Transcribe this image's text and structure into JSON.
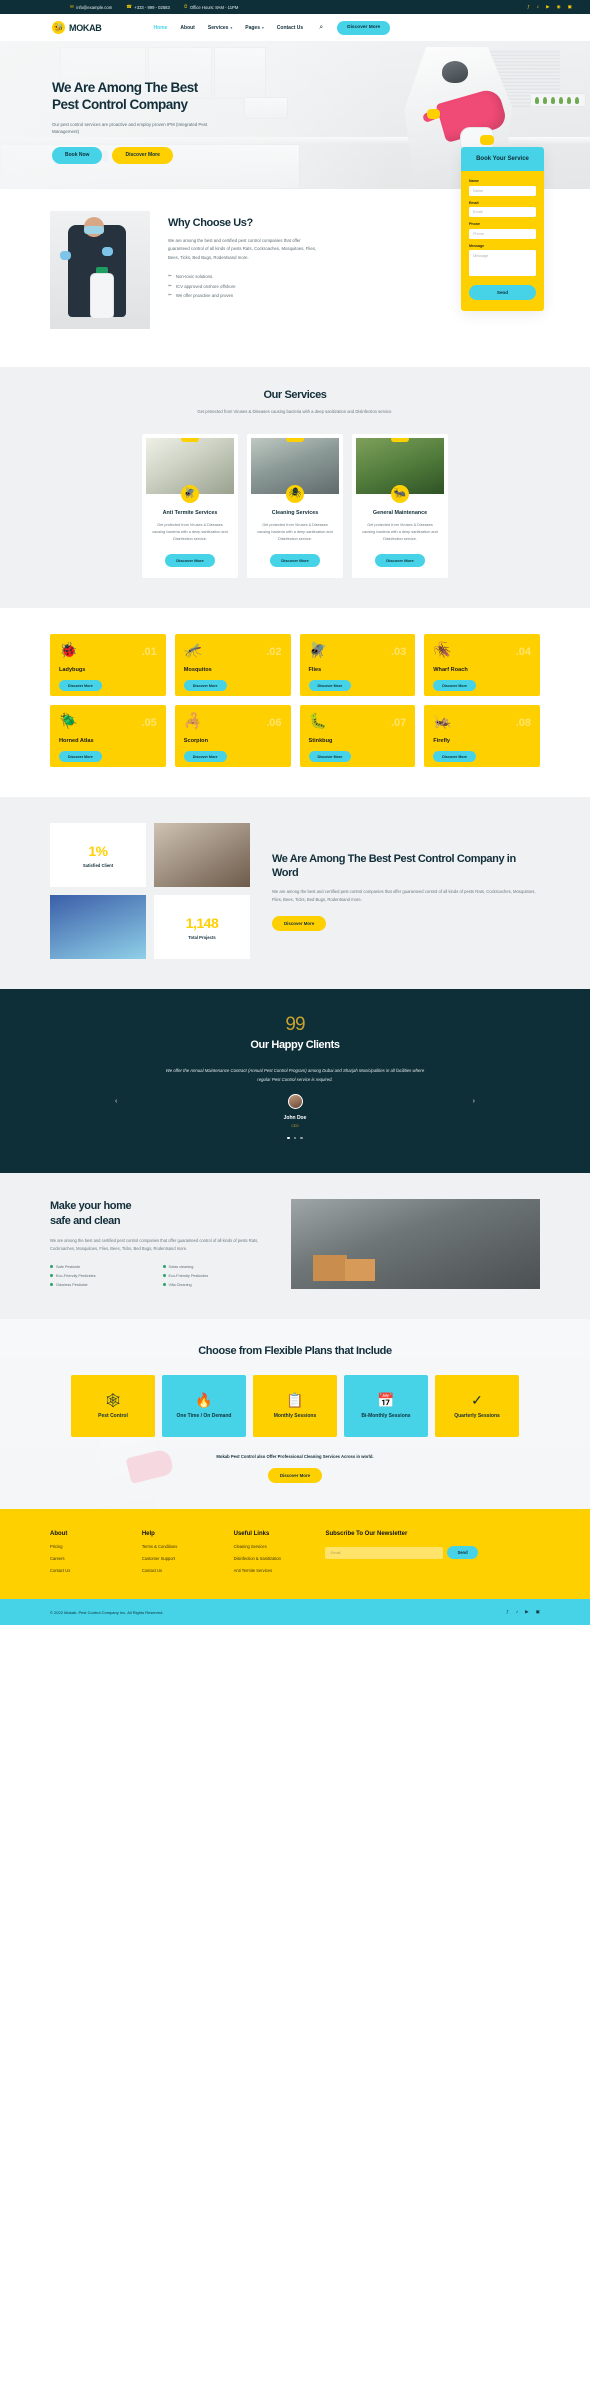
{
  "topbar": {
    "email": "info@example.com",
    "phone": "+333 - 999 - 02583",
    "hours": "Office Hours: 8AM - 11PM",
    "social": [
      "f",
      "t",
      "yt",
      "rss",
      "ig"
    ]
  },
  "nav": {
    "brand": "MOKAB",
    "links": [
      {
        "label": "Home",
        "active": true,
        "caret": ""
      },
      {
        "label": "About",
        "active": false,
        "caret": ""
      },
      {
        "label": "Services",
        "active": false,
        "caret": "▾"
      },
      {
        "label": "Pages",
        "active": false,
        "caret": "▾"
      },
      {
        "label": "Contact Us",
        "active": false,
        "caret": ""
      }
    ],
    "search_icon": "⌕",
    "cta": "Discover More"
  },
  "hero": {
    "title_line1": "We Are Among The Best",
    "title_line2": "Pest Control Company",
    "subtitle": "Our pest control services are proactive and employ proven IPM (Integrated Pest Management)",
    "btn_primary": "Book Now",
    "btn_secondary": "Discover More"
  },
  "book_form": {
    "heading": "Book Your Service",
    "fields": [
      {
        "label": "Name",
        "placeholder": "Name"
      },
      {
        "label": "Email",
        "placeholder": "Email"
      },
      {
        "label": "Phone",
        "placeholder": "Phone"
      },
      {
        "label": "Message",
        "placeholder": "Message"
      }
    ],
    "send": "Send"
  },
  "why": {
    "heading": "Why Choose Us?",
    "paragraph": "We are among the best and certified pest control companies that offer guaranteed control of all kinds of pests Rats, Cockroaches, Mosquitoes, Flies, Bees, Ticks, Bed Bugs, Rodentsand more.",
    "bullets": [
      "Non-toxic solutions.",
      "ICV approved onshore offshore",
      "We offer proactive and proven"
    ]
  },
  "services": {
    "heading": "Our Services",
    "subtitle": "Get protected from Viruses & Diseases causing bacteria with a deep sanitization and Disinfection service.",
    "cards": [
      {
        "title": "Anti Termite Services",
        "desc": "Get protected from Viruses & Diseases causing bacteria with a deep sanitization and Disinfection service.",
        "button": "Discover More",
        "icon": "🪰"
      },
      {
        "title": "Cleaning Services",
        "desc": "Get protected from Viruses & Diseases causing bacteria with a deep sanitization and Disinfection service.",
        "button": "Discover More",
        "icon": "🕷"
      },
      {
        "title": "General Maintenance",
        "desc": "Get protected from Viruses & Diseases causing bacteria with a deep sanitization and Disinfection service.",
        "button": "Discover More",
        "icon": "🐜"
      }
    ]
  },
  "pests": {
    "items": [
      {
        "num": ".01",
        "name": "Ladybugs",
        "icon": "🐞",
        "button": "Discover More"
      },
      {
        "num": ".02",
        "name": "Mosquitos",
        "icon": "🦟",
        "button": "Discover More"
      },
      {
        "num": ".03",
        "name": "Flies",
        "icon": "🪰",
        "button": "Discover More"
      },
      {
        "num": ".04",
        "name": "Wharf Roach",
        "icon": "🪳",
        "button": "Discover More"
      },
      {
        "num": ".05",
        "name": "Horned Atlas",
        "icon": "🪲",
        "button": "Discover More"
      },
      {
        "num": ".06",
        "name": "Scorpion",
        "icon": "🦂",
        "button": "Discover More"
      },
      {
        "num": ".07",
        "name": "Stinkbug",
        "icon": "🐛",
        "button": "Discover More"
      },
      {
        "num": ".08",
        "name": "Firefly",
        "icon": "🦗",
        "button": "Discover More"
      }
    ]
  },
  "word": {
    "stats": [
      {
        "value": "1%",
        "label": "Satisfied Client"
      },
      {
        "value": "1,148",
        "label": "Total Projects"
      }
    ],
    "heading": "We Are Among The Best Pest Control Company in Word",
    "paragraph": "We are among the best and certified pest control companies that offer guaranteed control of all kinds of pests Rats, Cockroaches, Mosquitoes, Flies, Bees, Ticks, Bed Bugs, Rodentsand more.",
    "button": "Discover More"
  },
  "testimonial": {
    "quote_mark": "99",
    "heading": "Our Happy Clients",
    "quote": "We offer the Annual Maintenance Contract (Annual Pest Control Program) among Dubai and Sharjah Municipalities in all facilities where regular Pest Control service is required.",
    "name": "John Doe",
    "role": "CEO",
    "prev": "‹",
    "next": "›",
    "dots": 3,
    "active_dot": 0
  },
  "safe": {
    "heading_line1": "Make your home",
    "heading_line2": "safe and clean",
    "paragraph": "We are among the best and certified pest control companies that offer guaranteed control of all kinds of pests Rats, Cockroaches, Mosquitoes, Flies, Bees, Ticks, Bed Bugs, Rodentsand more.",
    "features": [
      "Safe Pesticide",
      "Sofas cleaning",
      "Eco-Friendly Pesticides",
      "Eco-Friendly Pesticides",
      "Odorless Pesticide",
      "Villa Cleaning"
    ]
  },
  "plans": {
    "heading": "Choose from Flexible Plans that Include",
    "cards": [
      {
        "label": "Pest Control",
        "icon": "🕸",
        "color": "yellow"
      },
      {
        "label": "One Time / On Demand",
        "icon": "🔥",
        "color": "cyan"
      },
      {
        "label": "Monthly Sessions",
        "icon": "📋",
        "color": "yellow"
      },
      {
        "label": "Bi-Monthly Sessions",
        "icon": "📅",
        "color": "cyan"
      },
      {
        "label": "Quarterly Sessions",
        "icon": "✓",
        "color": "yellow"
      }
    ],
    "note": "Mokab Pest Control also Offer Professional Cleaning Services Across in world.",
    "button": "Discover More"
  },
  "footer": {
    "columns": [
      {
        "heading": "About",
        "links": [
          "Pricing",
          "Careers",
          "Contact Us"
        ]
      },
      {
        "heading": "Help",
        "links": [
          "Terms & Conditions",
          "Customer Support",
          "Contact Us"
        ]
      },
      {
        "heading": "Useful Links",
        "links": [
          "Cleaning Services",
          "Disinfection & Sanitization",
          "Anti Termite Services"
        ]
      }
    ],
    "newsletter": {
      "heading": "Subscribe To Our Newsletter",
      "placeholder": "Email",
      "button": "Send"
    },
    "copyright": "© 2022 Mokab- Pest Control Company Inc. All Rights Reserved.",
    "social": [
      "f",
      "t",
      "yt",
      "in"
    ]
  },
  "colors": {
    "yellow": "#ffd000",
    "cyan": "#46d3e8",
    "dark": "#0e2f38",
    "gray_bg": "#f0f1f2"
  }
}
